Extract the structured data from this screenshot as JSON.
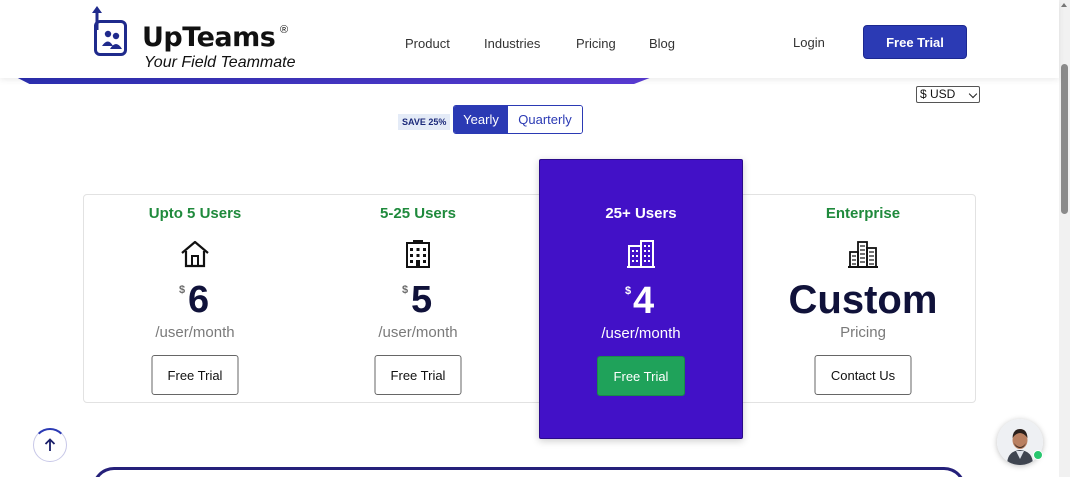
{
  "brand": {
    "name": "UpTeams",
    "registered": "®",
    "tagline": "Your Field Teammate"
  },
  "nav": {
    "items": [
      "Product",
      "Industries",
      "Pricing",
      "Blog"
    ],
    "login": "Login",
    "cta": "Free Trial"
  },
  "currency": {
    "selected": "$ USD"
  },
  "billing": {
    "save_badge": "SAVE 25%",
    "options": [
      "Yearly",
      "Quarterly"
    ],
    "selected": "Yearly"
  },
  "plans": [
    {
      "title": "Upto 5 Users",
      "icon": "house-icon",
      "currency_symbol": "$",
      "price": "6",
      "unit": "/user/month",
      "button": "Free Trial"
    },
    {
      "title": "5-25 Users",
      "icon": "office-building-icon",
      "currency_symbol": "$",
      "price": "5",
      "unit": "/user/month",
      "button": "Free Trial"
    },
    {
      "title": "25+ Users",
      "icon": "city-buildings-icon",
      "currency_symbol": "$",
      "price": "4",
      "unit": "/user/month",
      "button": "Free Trial",
      "featured": true
    },
    {
      "title": "Enterprise",
      "icon": "skyscrapers-icon",
      "price": "Custom",
      "unit": "Pricing",
      "button": "Contact Us"
    }
  ],
  "colors": {
    "brand_blue": "#2b3ab4",
    "featured_purple": "#4211c7",
    "title_green": "#1f8a3c",
    "cta_green": "#1fa25a"
  }
}
